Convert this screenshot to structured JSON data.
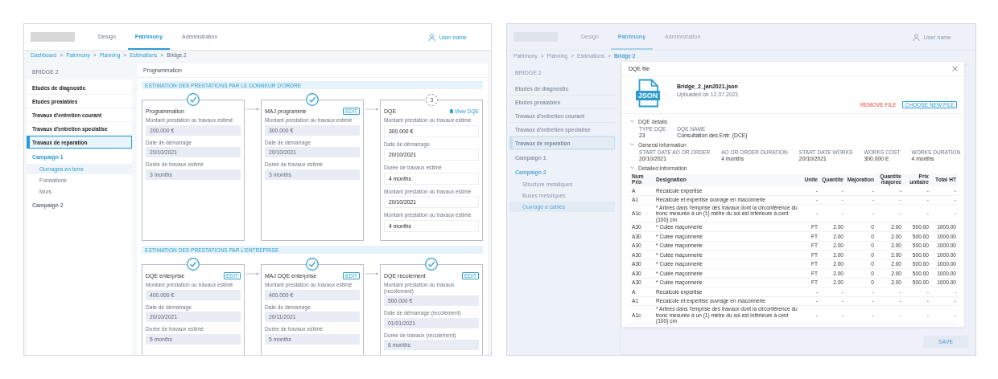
{
  "left_screen": {
    "header": {
      "tabs": [
        {
          "label": "Design",
          "selected": false
        },
        {
          "label": "Patrimony",
          "selected": true
        },
        {
          "label": "Administration",
          "selected": false
        }
      ],
      "user": "User name"
    },
    "breadcrumb": {
      "separator": ">",
      "items": [
        "Dashboard",
        "Patrimony",
        "Planning",
        "Estimations",
        "Bridge 2"
      ]
    },
    "sidebar": {
      "title": "BRIDGE 2",
      "items": [
        {
          "kind": "category",
          "label": "Etudes de diagnostic",
          "selected": false
        },
        {
          "kind": "category",
          "label": "Etudes prealables",
          "selected": false
        },
        {
          "kind": "category",
          "label": "Travaux d'entretien courant",
          "selected": false
        },
        {
          "kind": "category",
          "label": "Travaux d'entretien specialise",
          "selected": false
        },
        {
          "kind": "category",
          "label": "Travaux de reparation",
          "selected": true
        },
        {
          "kind": "campaign",
          "label": "Campaign 1",
          "expanded": true,
          "children": [
            {
              "label": "Ouvrages en terre",
              "selected": true
            },
            {
              "label": "Fondations",
              "selected": false
            },
            {
              "label": "Murs",
              "selected": false
            }
          ]
        },
        {
          "kind": "campaign",
          "label": "Campaign 2",
          "expanded": false
        }
      ]
    },
    "panel": {
      "title": "Programmation",
      "sections": [
        {
          "heading": "ESTIMATION DES PRESTATIONS PAR LE DONNEUR D'ORDRE",
          "steps": [
            {
              "title": "Programmation",
              "completed": true,
              "editable": false,
              "fields": [
                {
                  "label": "Montant prestation ou travaux estimé",
                  "value": "200.000 €"
                },
                {
                  "label": "Date de démarrage",
                  "value": "20/10/2021"
                },
                {
                  "label": "Durée de travaux estimé",
                  "value": "3 months"
                }
              ]
            },
            {
              "title": "MAJ programme",
              "completed": true,
              "editable": false,
              "button": "EDIT",
              "fields": [
                {
                  "label": "Montant prestation ou travaux estimé",
                  "value": "300.000 €"
                },
                {
                  "label": "Date de démarrage",
                  "value": "20/10/2021"
                },
                {
                  "label": "Durée de travaux estimé",
                  "value": "3 months"
                }
              ]
            },
            {
              "title": "DQE",
              "completed": false,
              "number": "3",
              "editable": true,
              "link": "View DQE",
              "fields": [
                {
                  "label": "Montant prestation ou travaux estimé",
                  "value": "300.000 €"
                },
                {
                  "label": "Date de démarrage",
                  "value": "20/10/2021"
                },
                {
                  "label": "Durée de travaux estimé",
                  "value": "4 months"
                },
                {
                  "label": "Montant prestation ou travaux estimé",
                  "value": "20/10/2021"
                },
                {
                  "label": "Montant prestation ou travaux estimé",
                  "value": "4 months"
                }
              ]
            }
          ]
        },
        {
          "heading": "ESTIMATION DES PRESTATIONS PAR L'ENTREPRISE",
          "steps": [
            {
              "title": "DQE enterprise",
              "completed": true,
              "editable": false,
              "button": "EDIT",
              "fields": [
                {
                  "label": "Montant prestation ou travaux estimé",
                  "value": "400.000 €"
                },
                {
                  "label": "Date de démarrage",
                  "value": "20/10/2021"
                },
                {
                  "label": "Durée de travaux estimé",
                  "value": "5 months"
                }
              ]
            },
            {
              "title": "MAJ DQE enterprise",
              "completed": true,
              "editable": false,
              "button": "EDIT",
              "fields": [
                {
                  "label": "Montant prestation ou travaux estimé",
                  "value": "400.000 €"
                },
                {
                  "label": "Date de démarrage",
                  "value": "20/11/2021"
                },
                {
                  "label": "Durée de travaux estimé",
                  "value": "5 months"
                }
              ]
            },
            {
              "title": "DQE récolement",
              "completed": true,
              "editable": false,
              "button": "EDIT",
              "fields": [
                {
                  "label": "Montant prestation ou travaux (recolement)",
                  "value": "500.000 €"
                },
                {
                  "label": "Date de démarrage (recolement)",
                  "value": "01/01/2021"
                },
                {
                  "label": "Durée de travaux (recolement)",
                  "value": "6 months"
                }
              ]
            }
          ]
        }
      ]
    }
  },
  "right_screen": {
    "header": {
      "tabs": [
        {
          "label": "Design",
          "selected": false
        },
        {
          "label": "Patrimony",
          "selected": true
        },
        {
          "label": "Administration",
          "selected": false
        }
      ],
      "user": "User name"
    },
    "breadcrumb": {
      "separator": ">",
      "items": [
        "Patrimony",
        "Planning",
        "Estimations",
        "Bridge 2"
      ]
    },
    "sidebar": {
      "title": "BRIDGE 2",
      "items": [
        {
          "kind": "category",
          "label": "Etudes de diagnostic",
          "selected": false
        },
        {
          "kind": "category",
          "label": "Etudes prealables",
          "selected": false
        },
        {
          "kind": "category",
          "label": "Travaux d'entretien courant",
          "selected": false
        },
        {
          "kind": "category",
          "label": "Travaux d'entretien specialise",
          "selected": false
        },
        {
          "kind": "category",
          "label": "Travaux de reparation",
          "selected": true
        },
        {
          "kind": "campaign",
          "label": "Campaign 1",
          "expanded": false
        },
        {
          "kind": "campaign",
          "label": "Campaign 2",
          "expanded": true,
          "children": [
            {
              "label": "Structure metaliques",
              "selected": false
            },
            {
              "label": "Buses metaliques",
              "selected": false
            },
            {
              "label": "Ouvrage a cables",
              "selected": true
            }
          ]
        }
      ]
    },
    "save_button": "SAVE",
    "dialog": {
      "title": "DQE file",
      "file": {
        "icon_label": "JSON",
        "name": "Bridge_2_jan2021.json",
        "uploaded": "Uploaded on 12.07.2021"
      },
      "actions": [
        {
          "kind": "danger",
          "label": "REMOVE FILE"
        },
        {
          "kind": "outline",
          "label": "CHOOSE NEW FILE"
        }
      ],
      "groups": [
        {
          "title": "DQE details",
          "expanded": true,
          "fields": [
            {
              "label": "TYPE DQE",
              "value": "23"
            },
            {
              "label": "DQE NAME",
              "value": "Consultation des Entr. (DCE)"
            }
          ]
        },
        {
          "title": "General information",
          "expanded": true,
          "fields": [
            {
              "label": "START DATE AO OR ORDER",
              "value": "20/10/2021"
            },
            {
              "label": "AO OR ORDER DURATION",
              "value": "4 months"
            },
            {
              "label": "START DATE WORKS",
              "value": "20/10/2021"
            },
            {
              "label": "WORKS COST",
              "value": "300.000 E"
            },
            {
              "label": "WORKS DURATION",
              "value": "4 months"
            }
          ]
        },
        {
          "title": "Detailed information",
          "expanded": true
        }
      ],
      "table": {
        "columns": [
          "Num Prix",
          "Designation",
          "Unite",
          "Quantite",
          "Majoration",
          "Quantite majoree",
          "Prix unitaire",
          "Total HT"
        ],
        "rows": [
          [
            "A",
            "Recalcule expertise",
            "-",
            "-",
            "-",
            "-",
            "-",
            "-"
          ],
          [
            "A1",
            "Recalcule et expertise ouvrage en maconnerie",
            "-",
            "-",
            "-",
            "-",
            "-",
            "-"
          ],
          [
            "A1c",
            "* Arbres dans l'emprise des travaux dont la circonférence du tronc mesurée à un (1) mètre du sol est inférieure à cent (100) cm",
            "-",
            "-",
            "-",
            "-",
            "-",
            "-"
          ],
          [
            "A30",
            "* Culée maçonnerie",
            "FT",
            "2.00",
            "0",
            "2.00",
            "500.00",
            "1000.00"
          ],
          [
            "A30",
            "* Culée maçonnerie",
            "FT",
            "2.00",
            "0",
            "2.00",
            "500.00",
            "1000.00"
          ],
          [
            "A30",
            "* Culée maçonnerie",
            "FT",
            "2.00",
            "0",
            "2.00",
            "500.00",
            "1000.00"
          ],
          [
            "A30",
            "* Culée maçonnerie",
            "FT",
            "2.00",
            "0",
            "2.00",
            "500.00",
            "1000.00"
          ],
          [
            "A30",
            "* Culée maçonnerie",
            "FT",
            "2.00",
            "0",
            "2.00",
            "500.00",
            "1000.00"
          ],
          [
            "A30",
            "* Culée maçonnerie",
            "FT",
            "2.00",
            "0",
            "2.00",
            "500.00",
            "1000.00"
          ],
          [
            "A30",
            "* Culée maçonnerie",
            "FT",
            "2.00",
            "0",
            "2.00",
            "500.00",
            "1000.00"
          ],
          [
            "A",
            "Recalcule expertise",
            "-",
            "-",
            "-",
            "-",
            "-",
            "-"
          ],
          [
            "A1",
            "Recalcule et expertise ouvrage en maconnerie",
            "-",
            "-",
            "-",
            "-",
            "-",
            "-"
          ],
          [
            "A1c",
            "* Arbres dans l'emprise des travaux dont la circonférence du tronc mesurée à un (1) mètre du sol est inférieure à cent (100) cm",
            "-",
            "-",
            "-",
            "-",
            "-",
            "-"
          ]
        ]
      }
    }
  }
}
